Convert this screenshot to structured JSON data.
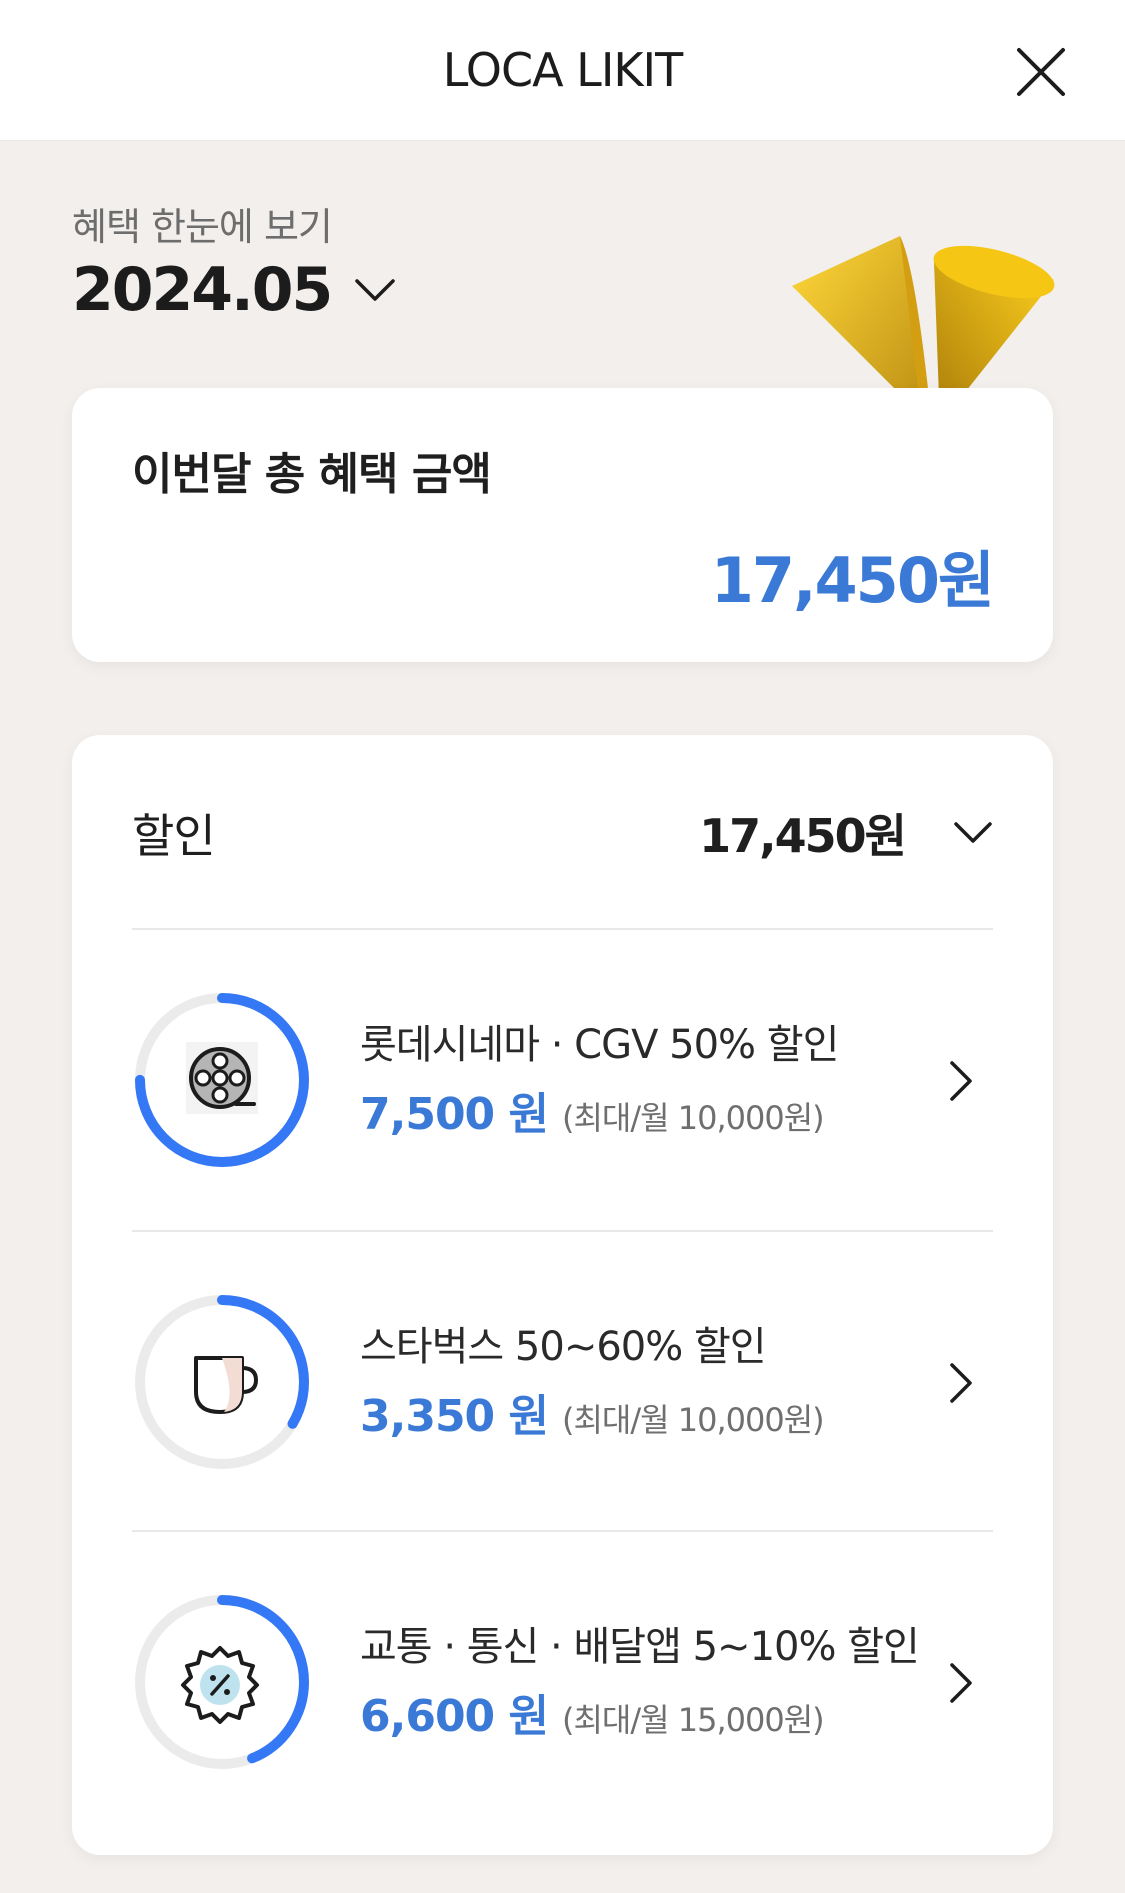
{
  "header": {
    "title": "LOCA LIKIT"
  },
  "summary": {
    "subtitle": "혜택 한눈에 보기",
    "month": "2024.05",
    "total_label": "이번달 총 혜택 금액",
    "total_amount": "17,450원"
  },
  "discount": {
    "title": "할인",
    "total": "17,450원",
    "items": [
      {
        "title": "롯데시네마 · CGV 50% 할인",
        "amount": "7,500 원",
        "limit": "(최대/월 10,000원)",
        "icon": "film-reel-icon",
        "progress": 0.75
      },
      {
        "title": "스타벅스 50~60% 할인",
        "amount": "3,350 원",
        "limit": "(최대/월 10,000원)",
        "icon": "coffee-cup-icon",
        "progress": 0.335
      },
      {
        "title": "교통 · 통신 · 배달앱 5~10% 할인",
        "amount": "6,600 원",
        "limit": "(최대/월 15,000원)",
        "icon": "discount-badge-icon",
        "progress": 0.44
      }
    ]
  },
  "colors": {
    "accent": "#3a79d6",
    "ring_progress": "#3478f6",
    "ring_track": "#ebebeb",
    "background": "#f2efec"
  }
}
